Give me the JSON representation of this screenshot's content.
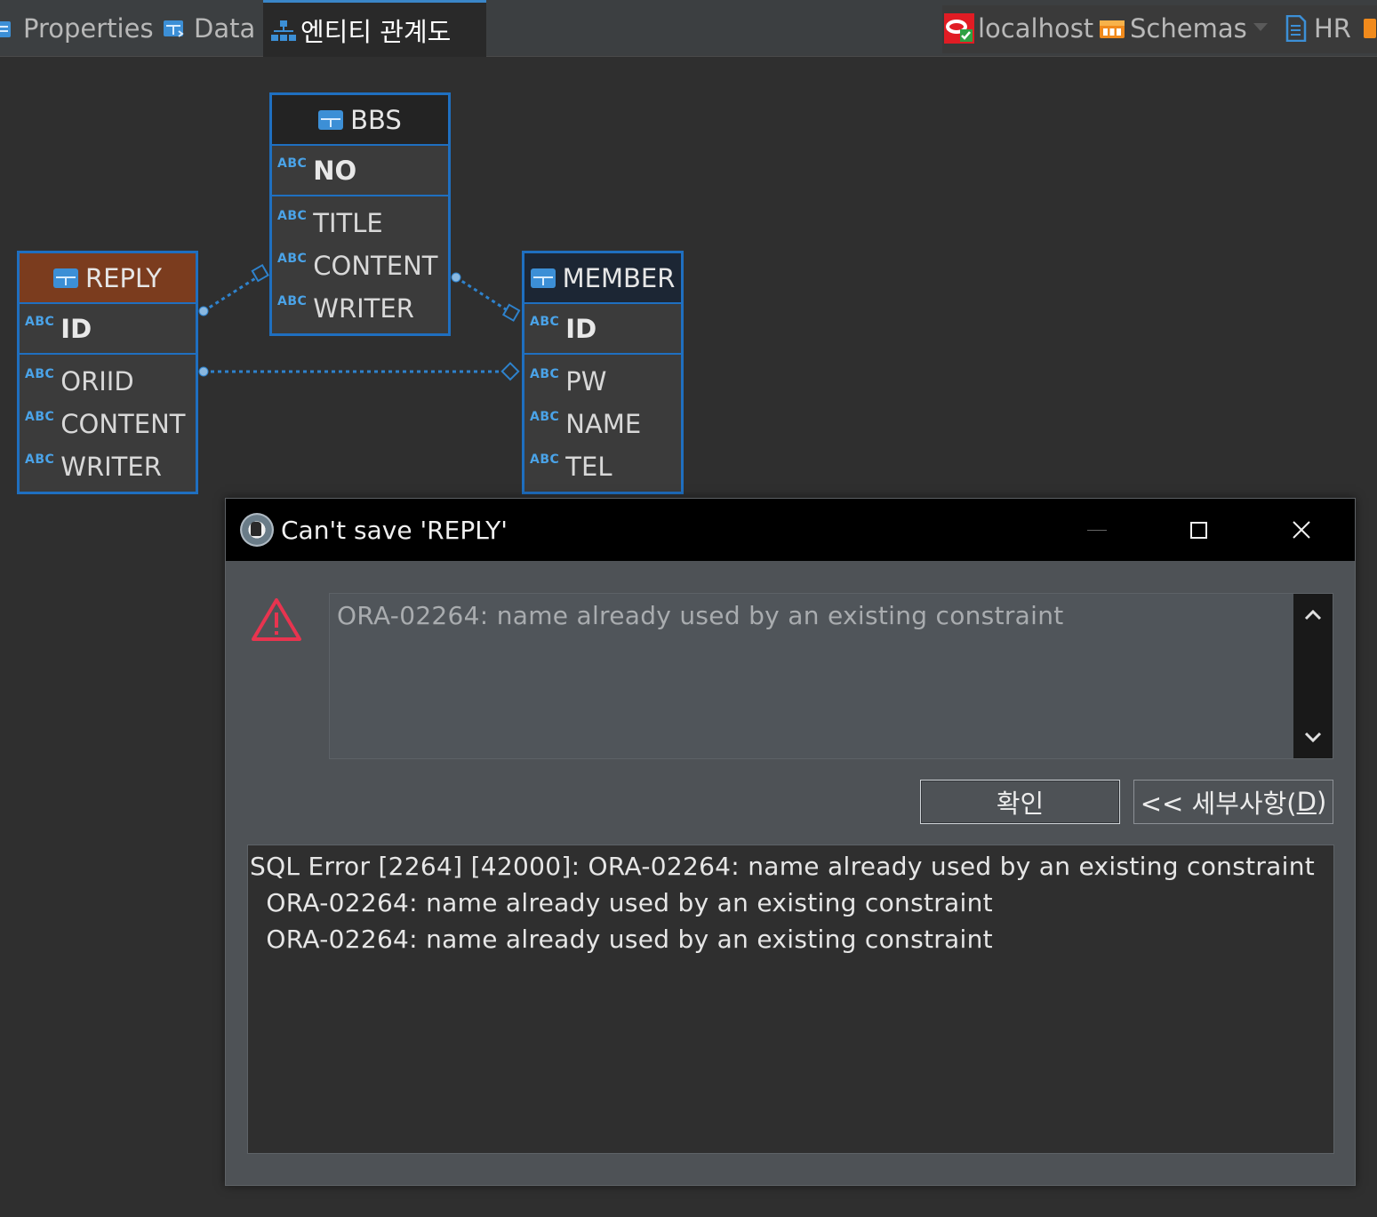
{
  "tabs": {
    "properties": "Properties",
    "data": "Data",
    "erd": "엔티티 관계도",
    "connection": "localhost",
    "schemas": "Schemas",
    "hr": "HR"
  },
  "entities": {
    "bbs": {
      "name": "BBS",
      "pk": "NO",
      "attrs": [
        "TITLE",
        "CONTENT",
        "WRITER"
      ]
    },
    "reply": {
      "name": "REPLY",
      "pk": "ID",
      "attrs": [
        "ORIID",
        "CONTENT",
        "WRITER"
      ]
    },
    "member": {
      "name": "MEMBER",
      "pk": "ID",
      "attrs": [
        "PW",
        "NAME",
        "TEL"
      ]
    },
    "type_badge": "ABC"
  },
  "dialog": {
    "title": "Can't save 'REPLY'",
    "message": "ORA-02264: name already used by an existing constraint",
    "ok_label": "확인",
    "details_prefix": "<< 세부사항(",
    "details_mnemonic": "D",
    "details_suffix": ")",
    "details": [
      "SQL Error [2264] [42000]: ORA-02264: name already used by an existing constraint",
      "  ORA-02264: name already used by an existing constraint",
      "  ORA-02264: name already used by an existing constraint"
    ]
  },
  "colors": {
    "accent": "#1f6fc0",
    "reply_header": "#7b3c1e",
    "warning": "#e8344f"
  }
}
